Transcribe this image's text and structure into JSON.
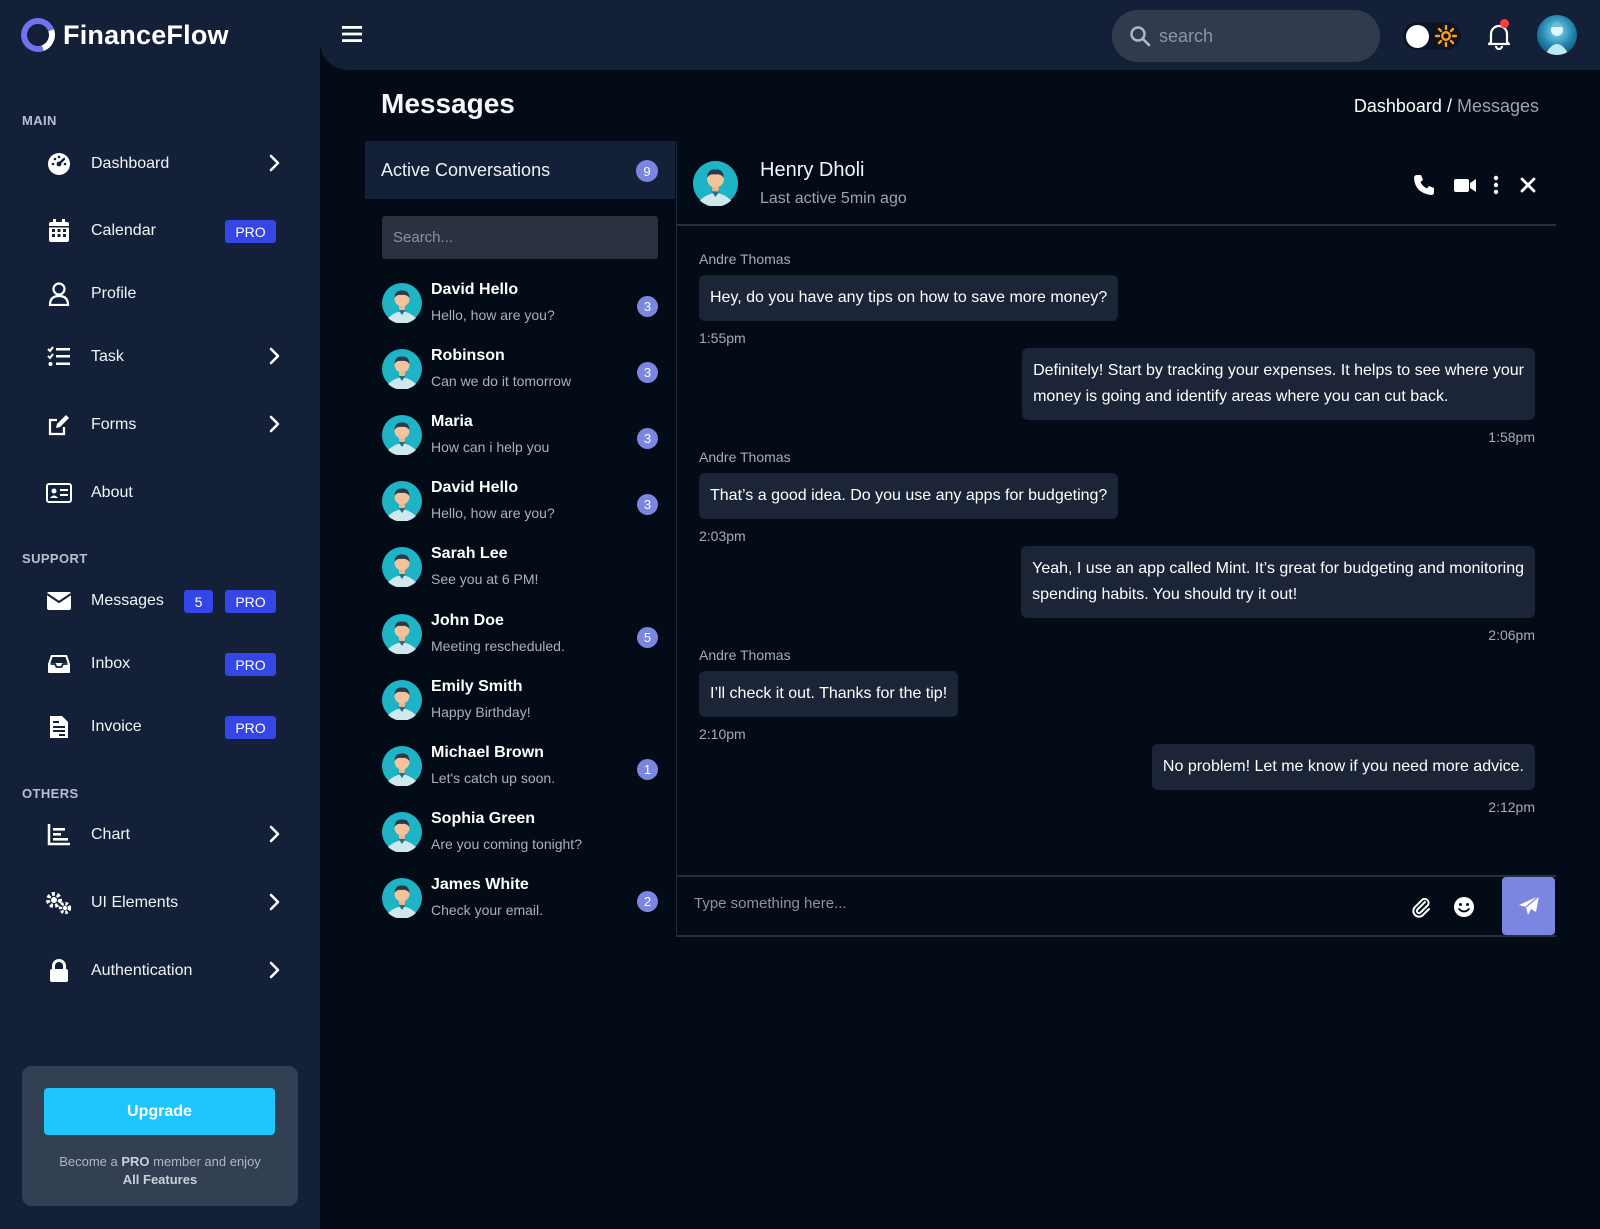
{
  "app": {
    "name": "FinanceFlow"
  },
  "header": {
    "search_placeholder": "search"
  },
  "sidebar": {
    "sections": {
      "main": "MAIN",
      "support": "SUPPORT",
      "others": "OTHERS"
    },
    "items": [
      {
        "label": "Dashboard",
        "icon": "gauge-icon"
      },
      {
        "label": "Calendar",
        "icon": "calendar-icon",
        "badge": "PRO"
      },
      {
        "label": "Profile",
        "icon": "user-icon"
      },
      {
        "label": "Task",
        "icon": "tasks-icon"
      },
      {
        "label": "Forms",
        "icon": "edit-icon"
      },
      {
        "label": "About",
        "icon": "id-card-icon"
      },
      {
        "label": "Messages",
        "icon": "envelope-icon",
        "count": "5",
        "badge": "PRO"
      },
      {
        "label": "Inbox",
        "icon": "inbox-icon",
        "badge": "PRO"
      },
      {
        "label": "Invoice",
        "icon": "invoice-icon",
        "badge": "PRO"
      },
      {
        "label": "Chart",
        "icon": "chart-icon"
      },
      {
        "label": "UI Elements",
        "icon": "cogs-icon"
      },
      {
        "label": "Authentication",
        "icon": "lock-icon"
      }
    ],
    "upgrade": {
      "button": "Upgrade",
      "text_1": "Become a ",
      "text_pro": "PRO",
      "text_2": " member and enjoy",
      "text_all": "All Features"
    }
  },
  "page": {
    "title": "Messages",
    "breadcrumb_home": "Dashboard",
    "breadcrumb_sep": " / ",
    "breadcrumb_current": "Messages"
  },
  "conversations": {
    "title": "Active Conversations",
    "count": "9",
    "search_placeholder": "Search...",
    "items": [
      {
        "name": "David Hello",
        "message": "Hello, how are you?",
        "unread": "3"
      },
      {
        "name": "Robinson",
        "message": "Can we do it tomorrow",
        "unread": "3"
      },
      {
        "name": "Maria",
        "message": "How can i help you",
        "unread": "3"
      },
      {
        "name": "David Hello",
        "message": "Hello, how are you?",
        "unread": "3"
      },
      {
        "name": "Sarah Lee",
        "message": "See you at 6 PM!",
        "unread": ""
      },
      {
        "name": "John Doe",
        "message": "Meeting rescheduled.",
        "unread": "5"
      },
      {
        "name": "Emily Smith",
        "message": "Happy Birthday!",
        "unread": ""
      },
      {
        "name": "Michael Brown",
        "message": "Let's catch up soon.",
        "unread": "1"
      },
      {
        "name": "Sophia Green",
        "message": "Are you coming tonight?",
        "unread": ""
      },
      {
        "name": "James White",
        "message": "Check your email.",
        "unread": "2"
      }
    ]
  },
  "chat": {
    "contact_name": "Henry Dholi",
    "status": "Last active 5min ago",
    "compose_placeholder": "Type something here...",
    "messages": [
      {
        "sender": "Andre Thomas",
        "text": "Hey, do you have any tips on how to save more money?",
        "time": "1:55pm"
      },
      {
        "text_1": "Definitely! Start by tracking your expenses. It helps to see where your",
        "text_2": "money is going and identify areas where you can cut back.",
        "time": "1:58pm"
      },
      {
        "sender": "Andre Thomas",
        "text": "That’s a good idea. Do you use any apps for budgeting?",
        "time": "2:03pm"
      },
      {
        "text_1": "Yeah, I use an app called Mint. It’s great for budgeting and monitoring",
        "text_2": "spending habits. You should try it out!",
        "time": "2:06pm"
      },
      {
        "sender": "Andre Thomas",
        "text": "I’ll check it out. Thanks for the tip!",
        "time": "2:10pm"
      },
      {
        "text": "No problem! Let me know if you need more advice.",
        "time": "2:12pm"
      }
    ]
  },
  "colors": {
    "accent": "#3446e6",
    "badge": "#7a86e0",
    "upgrade": "#1ec5ff",
    "sidebar": "#142037",
    "background": "#020b16"
  }
}
